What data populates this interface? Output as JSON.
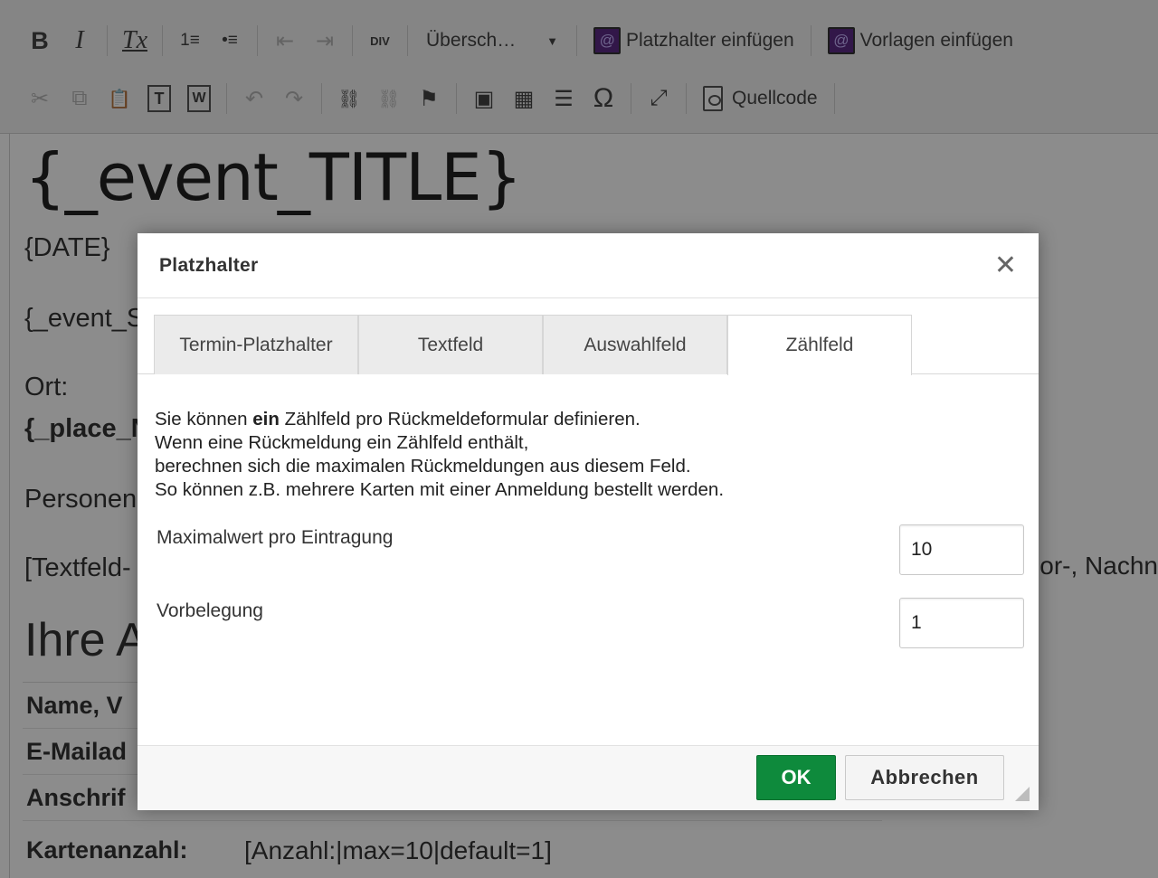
{
  "toolbar": {
    "row1": {
      "bold": "B",
      "italic": "I",
      "remove_format": "Tx",
      "numbered_list": "1≡",
      "bulleted_list": "•≡",
      "outdent": "⇤",
      "indent": "⇥",
      "div_container": "DIV",
      "format_combo": "Übersch…",
      "placeholder_button": "Platzhalter einfügen",
      "template_button": "Vorlagen einfügen"
    },
    "row2": {
      "cut": "✂",
      "copy": "⧉",
      "paste": "📋",
      "paste_text": "T",
      "paste_word": "W",
      "undo": "↶",
      "redo": "↷",
      "link": "⛓",
      "unlink": "⛓",
      "anchor": "⚑",
      "image": "▣",
      "table": "▦",
      "hr": "☰",
      "special_char": "Ω",
      "maximize": "⤢",
      "source_label": "Quellcode"
    }
  },
  "editor": {
    "title": "{_event_TITLE}",
    "date": "{DATE}",
    "event_line": "{_event_S",
    "ort_label": "Ort:",
    "place_line": "{_place_N",
    "personen_line": "Personen:",
    "textfeld_line": "[Textfeld-",
    "right_fragment": "or-, Nachn",
    "section_heading": "Ihre A",
    "table": [
      {
        "label": "Name, V",
        "value": ""
      },
      {
        "label": "E-Mailad",
        "value": ""
      },
      {
        "label": "Anschrif",
        "value": ""
      },
      {
        "label": "Kartenanzahl:",
        "value": "[Anzahl:|max=10|default=1]"
      }
    ]
  },
  "dialog": {
    "title": "Platzhalter",
    "close_icon": "✕",
    "tabs": [
      {
        "label": "Termin-Platzhalter",
        "active": false
      },
      {
        "label": "Textfeld",
        "active": false
      },
      {
        "label": "Auswahlfeld",
        "active": false
      },
      {
        "label": "Zählfeld",
        "active": true
      }
    ],
    "description": {
      "line1_prefix": "Sie können ",
      "line1_bold": "ein",
      "line1_suffix": " Zählfeld pro Rückmeldeformular definieren.",
      "line2": "Wenn eine Rückmeldung ein Zählfeld enthält,",
      "line3": "berechnen sich die maximalen Rückmeldungen aus diesem Feld.",
      "line4": "So können z.B. mehrere Karten mit einer Anmeldung bestellt werden."
    },
    "fields": {
      "max_label": "Maximalwert pro Eintragung",
      "max_value": "10",
      "default_label": "Vorbelegung",
      "default_value": "1"
    },
    "buttons": {
      "ok": "OK",
      "cancel": "Abbrechen"
    }
  }
}
